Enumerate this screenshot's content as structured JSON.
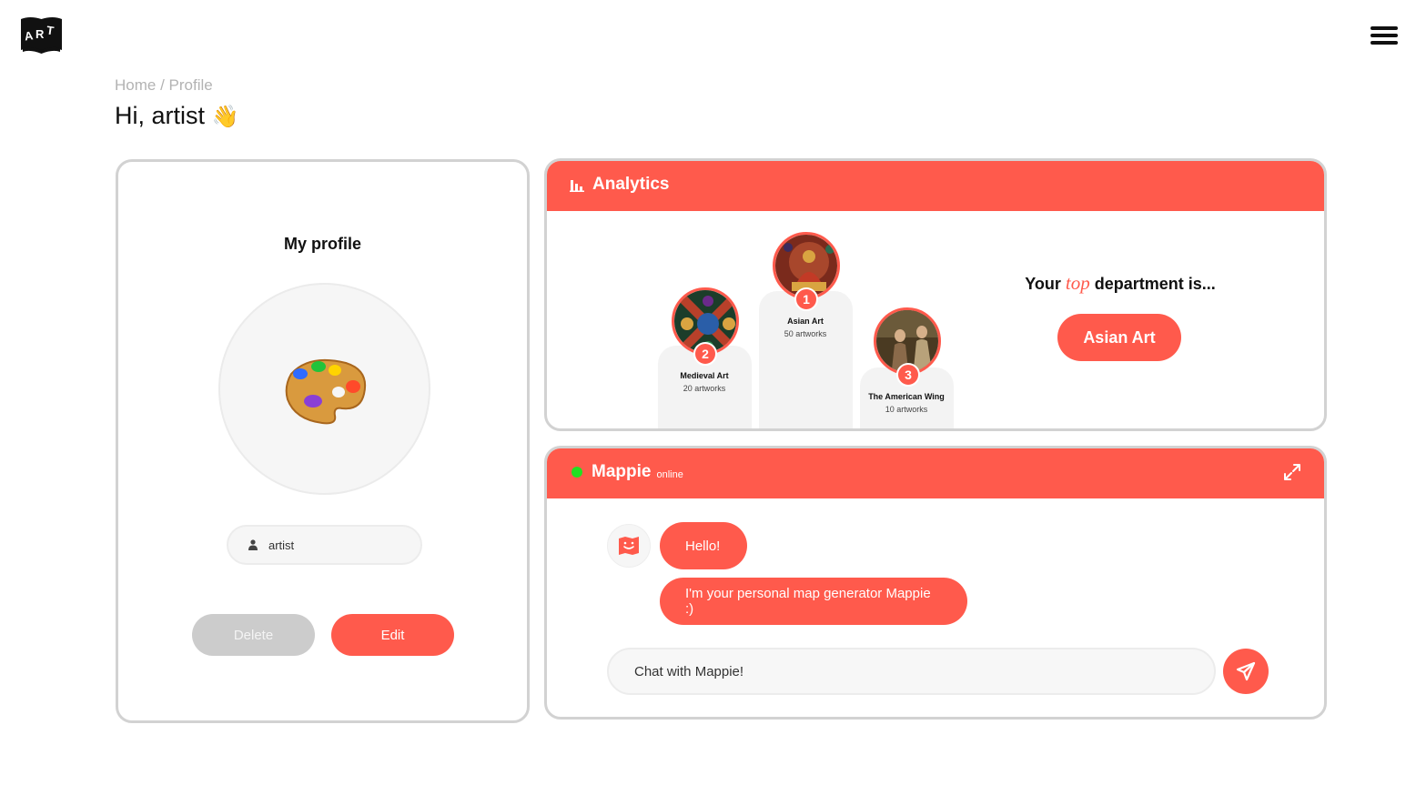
{
  "app": {
    "logo_text": "ART",
    "menu_icon": "hamburger-menu-icon"
  },
  "breadcrumb": "Home / Profile",
  "greeting": {
    "text": "Hi, artist",
    "emoji": "👋"
  },
  "profile": {
    "title": "My profile",
    "avatar_icon": "art-palette-icon",
    "username": "artist",
    "user_icon": "user-icon",
    "delete_label": "Delete",
    "edit_label": "Edit"
  },
  "analytics": {
    "title": "Analytics",
    "icon": "bar-chart-icon",
    "departments": [
      {
        "rank": "1",
        "name": "Asian Art",
        "count": "50 artworks"
      },
      {
        "rank": "2",
        "name": "Medieval Art",
        "count": "20 artworks"
      },
      {
        "rank": "3",
        "name": "The American Wing",
        "count": "10 artworks"
      }
    ],
    "top_prefix": "Your",
    "top_word": "top",
    "top_suffix": "department is...",
    "top_department": "Asian Art"
  },
  "chat": {
    "name": "Mappie",
    "status": "online",
    "expand_icon": "expand-icon",
    "bot_icon": "map-bot-icon",
    "messages": [
      "Hello!",
      "I'm your personal map generator Mappie :)"
    ],
    "input_placeholder": "Chat with Mappie!",
    "send_icon": "send-icon"
  },
  "colors": {
    "accent": "#ff5a4c",
    "online": "#22e022",
    "border": "#d2d2d2"
  }
}
